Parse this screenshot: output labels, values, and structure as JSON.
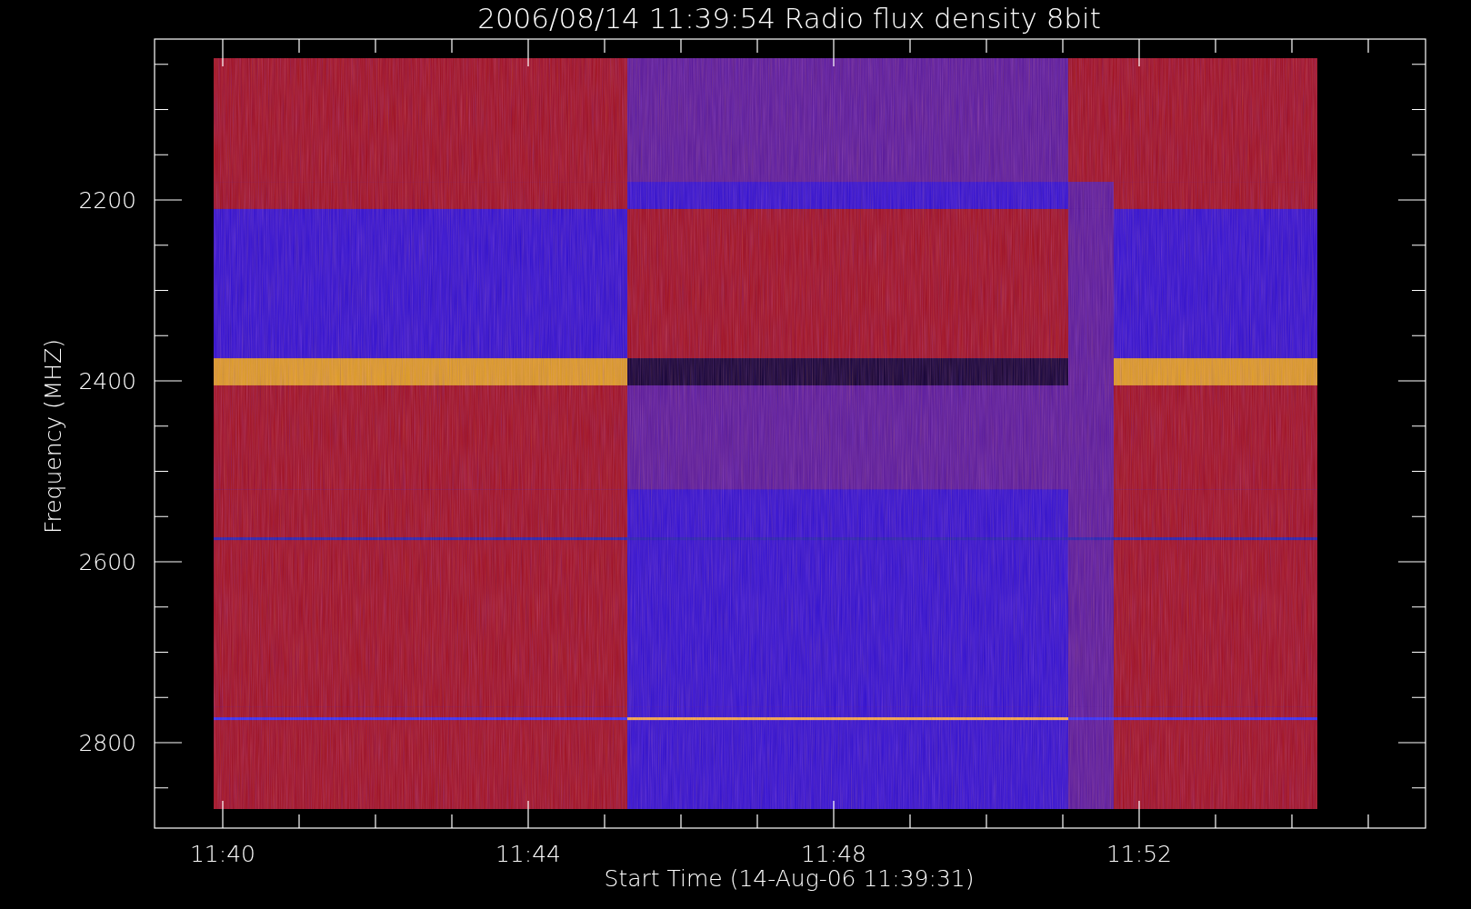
{
  "title": "2006/08/14 11:39:54 Radio flux density 8bit",
  "x_axis": {
    "label": "Start Time (14-Aug-06 11:39:31)",
    "ticks": [
      "11:40",
      "11:44",
      "11:48",
      "11:52"
    ]
  },
  "y_axis": {
    "label": "Frequency (MHZ)",
    "ticks": [
      "2200",
      "2400",
      "2600",
      "2800"
    ]
  }
}
